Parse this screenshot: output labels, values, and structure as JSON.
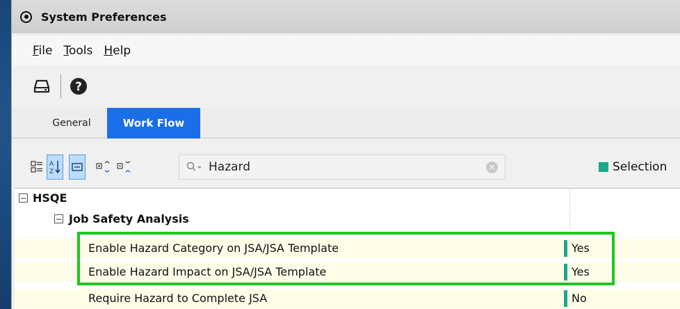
{
  "window": {
    "title": "System Preferences"
  },
  "menu": [
    {
      "label": "File",
      "mnemonic": "F",
      "rest": "ile"
    },
    {
      "label": "Tools",
      "mnemonic": "T",
      "rest": "ools"
    },
    {
      "label": "Help",
      "mnemonic": "H",
      "rest": "elp"
    }
  ],
  "toolbar": {
    "icons": [
      "drive-icon",
      "help-icon"
    ]
  },
  "tabs": [
    {
      "label": "General",
      "active": false
    },
    {
      "label": "Work Flow",
      "active": true
    }
  ],
  "filter": {
    "search_value": "Hazard",
    "legend_label": "Selection",
    "legend_color": "#1aa88a"
  },
  "grid": {
    "group": "HSQE",
    "subgroup": "Job Safety Analysis",
    "rows": [
      {
        "name": "Enable Hazard Category on JSA/JSA Template",
        "value": "Yes"
      },
      {
        "name": "Enable Hazard Impact on JSA/JSA Template",
        "value": "Yes"
      },
      {
        "name": "Require Hazard to Complete JSA",
        "value": "No"
      }
    ]
  },
  "colors": {
    "accent": "#1a6fe8",
    "marker": "#1aa88a",
    "highlight": "#21c421",
    "row_bg": "#fffde8"
  }
}
